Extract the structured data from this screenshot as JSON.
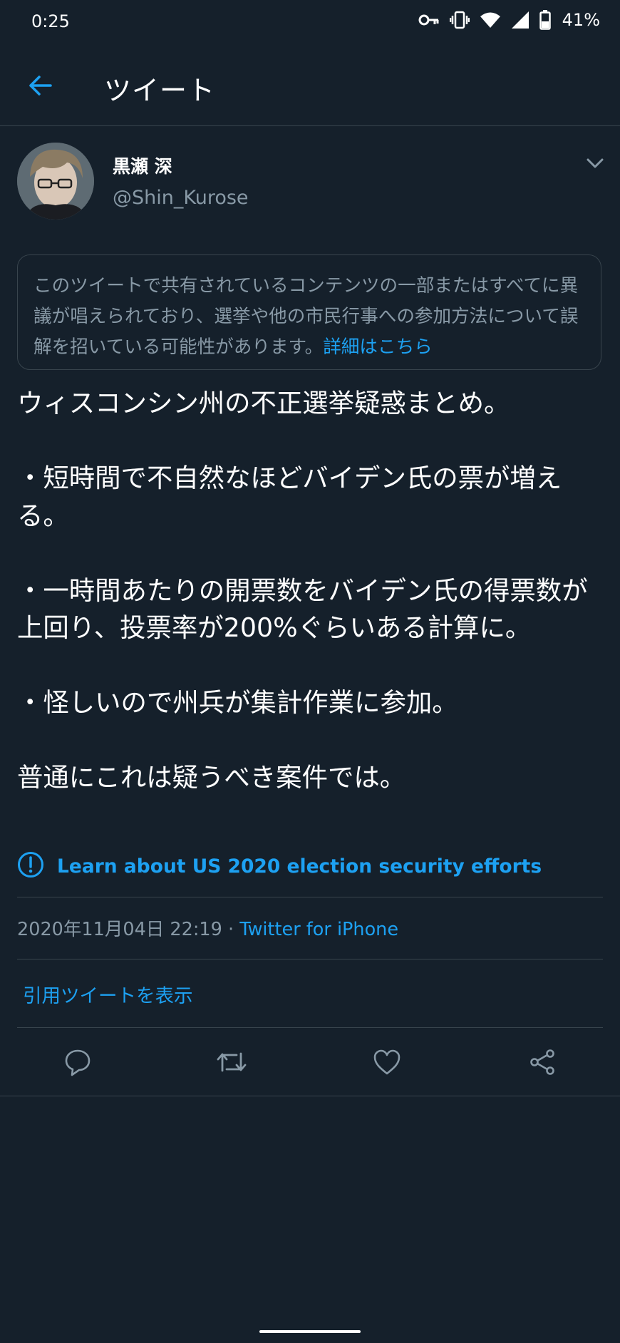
{
  "status_bar": {
    "time": "0:25",
    "battery": "41%",
    "icons": [
      "key-icon",
      "vibrate-icon",
      "wifi-icon",
      "signal-icon",
      "battery-icon"
    ]
  },
  "app_bar": {
    "title": "ツイート",
    "back_icon": "arrow-left-icon"
  },
  "author": {
    "name": "黒瀬 深",
    "handle": "@Shin_Kurose"
  },
  "notice": {
    "text": "このツイートで共有されているコンテンツの一部またはすべてに異議が唱えられており、選挙や他の市民行事への参加方法について誤解を招いている可能性があります。",
    "link": "詳細はこちら"
  },
  "tweet": {
    "lines": [
      "ウィスコンシン州の不正選挙疑惑まとめ。",
      "・短時間で不自然なほどバイデン氏の票が増える。",
      "・一時間あたりの開票数をバイデン氏の得票数が上回り、投票率が200%ぐらいある計算に。",
      "・怪しいので州兵が集計作業に参加。",
      "普通にこれは疑うべき案件では。"
    ]
  },
  "election_notice": {
    "text": "Learn about US 2020 election security efforts",
    "icon": "exclamation-circle-icon"
  },
  "meta": {
    "timestamp": "2020年11月04日 22:19",
    "separator": " · ",
    "source": "Twitter for iPhone"
  },
  "quote_link": "引用ツイートを表示",
  "actions": [
    "reply-icon",
    "retweet-icon",
    "like-icon",
    "share-icon"
  ],
  "colors": {
    "background": "#15202b",
    "accent": "#1da1f2",
    "secondary_text": "#8899a6",
    "border": "#38444d"
  }
}
